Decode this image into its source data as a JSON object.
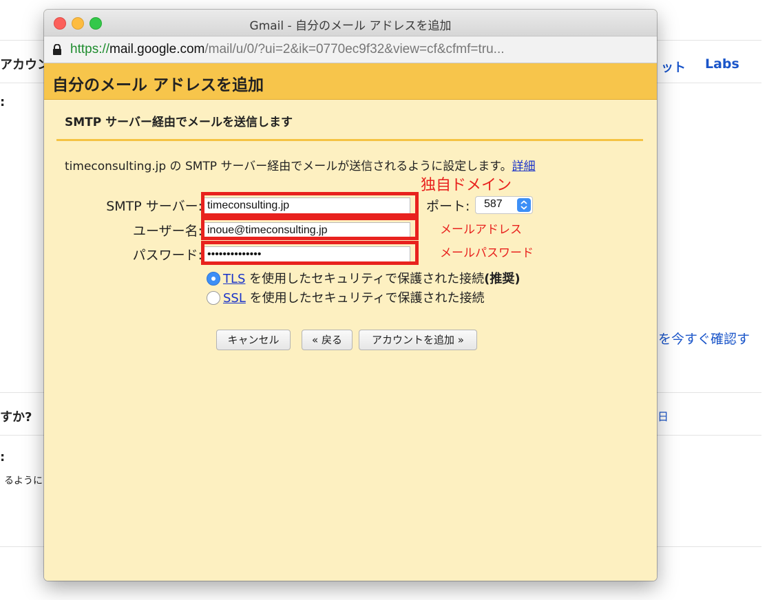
{
  "background": {
    "account_fragment": "アカウン",
    "colon_fragment_1": ":",
    "tab_fragment": "ット",
    "labs_link": "Labs",
    "check_now_fragment": "を今すぐ確認す",
    "question_fragment": "すか?",
    "colon_fragment_2": ":",
    "you_fragment": "るように",
    "small_fragment": "日"
  },
  "window": {
    "title": "Gmail - 自分のメール アドレスを追加",
    "url_scheme": "https://",
    "url_host": "mail.google.com",
    "url_rest": "/mail/u/0/?ui=2&ik=0770ec9f32&view=cf&cfmf=tru..."
  },
  "dialog": {
    "title": "自分のメール アドレスを追加",
    "section_title": "SMTP サーバー経由でメールを送信します",
    "description": "timeconsulting.jp の SMTP サーバー経由でメールが送信されるように設定します。",
    "details_link": "詳細",
    "smtp_label": "SMTP サーバー:",
    "smtp_value": "timeconsulting.jp",
    "port_label": "ポート:",
    "port_value": "587",
    "username_label": "ユーザー名:",
    "username_value": "inoue@timeconsulting.jp",
    "password_label": "パスワード:",
    "password_value": "••••••••••••••",
    "tls_link": "TLS",
    "tls_text": " を使用したセキュリティで保護された接続",
    "tls_recommended": "(推奨)",
    "ssl_link": "SSL",
    "ssl_text": " を使用したセキュリティで保護された接続",
    "cancel_button": "キャンセル",
    "back_button": "« 戻る",
    "add_account_button": "アカウントを追加 »"
  },
  "annotations": {
    "own_domain": "独自ドメイン",
    "mail_address": "メールアドレス",
    "mail_password": "メールパスワード"
  },
  "colors": {
    "header_yellow": "#f7c54b",
    "dialog_bg": "#fdf0c1",
    "annotation_red": "#e8221e",
    "link_blue": "#1a33c9"
  },
  "icons": [
    "lock-icon",
    "chevron-updown-icon"
  ]
}
